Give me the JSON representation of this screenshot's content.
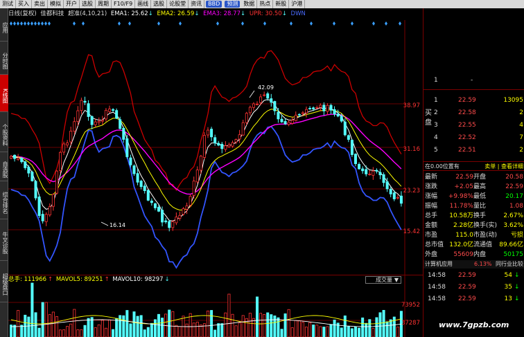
{
  "toolbar": [
    "测试",
    "买入",
    "卖出",
    "模拟",
    "开户",
    "选股",
    "周期",
    "F10/F9",
    "画线",
    "选股",
    "论股堂",
    "资讯",
    "BBD",
    "预测",
    "数据",
    "热点",
    "新股",
    "沪港"
  ],
  "side_tabs": [
    {
      "label": "应用",
      "active": false
    },
    {
      "label": "分时图",
      "active": false
    },
    {
      "label": "K线图",
      "active": true
    },
    {
      "label": "个股资料",
      "active": false
    },
    {
      "label": "自选股",
      "active": false
    },
    {
      "label": "综合排名",
      "active": false
    },
    {
      "label": "牛叉诊股",
      "active": false
    },
    {
      "label": "超级盘口",
      "active": false
    }
  ],
  "legend": {
    "period": "日线(复权)",
    "stock": "佳都科技",
    "indicator": "超准(4,10,21)",
    "ema1": "EMA1: 25.62",
    "ema2": "EMA2: 26.59",
    "ema3": "EMA3: 28.77",
    "upr": "UPR: 30.50",
    "dwn": "DWN: 23.17"
  },
  "kline": {
    "price_labels": [
      "38.97",
      "31.16",
      "23.23",
      "15.42"
    ],
    "high_label": "42.09",
    "low_label": "16.14",
    "colors": {
      "up": "#ff3333",
      "down": "#54ffff",
      "ema1": "#ffffff",
      "ema2": "#ffff00",
      "ema3": "#ff00ff",
      "upr": "#cc0000",
      "dwn": "#3355ff"
    }
  },
  "volume": {
    "total": "总手: 111966",
    "mavol5": "MAVOL5: 89251",
    "mavol10": "MAVOL10: 98297",
    "arrow_up": "↑",
    "arrow_down": "↓",
    "labels": [
      "73952",
      "37287"
    ],
    "indicator_select": "成交量"
  },
  "orderbook": {
    "ask": [
      {
        "idx": "1",
        "price": "",
        "vol": "",
        "sep": "-"
      }
    ],
    "bid_label": "买盘",
    "bid": [
      {
        "idx": "1",
        "price": "22.59",
        "vol": "13095"
      },
      {
        "idx": "2",
        "price": "22.58",
        "vol": "2"
      },
      {
        "idx": "3",
        "price": "22.55",
        "vol": "4"
      },
      {
        "idx": "4",
        "price": "22.52",
        "vol": "7"
      },
      {
        "idx": "5",
        "price": "22.51",
        "vol": "2"
      }
    ]
  },
  "position": {
    "left": "在0.00位置有",
    "right": "卖单 | 查看详细"
  },
  "stats": [
    {
      "l1": "最新",
      "v1": "22.59",
      "c1": "#ff4b4b",
      "l2": "开盘",
      "v2": "20.58",
      "c2": "#ff4b4b"
    },
    {
      "l1": "涨跌",
      "v1": "+2.05",
      "c1": "#ff4b4b",
      "l2": "最高",
      "v2": "22.59",
      "c2": "#ff4b4b"
    },
    {
      "l1": "涨幅",
      "v1": "+9.98%",
      "c1": "#ff4b4b",
      "l2": "最低",
      "v2": "20.17",
      "c2": "#00ff00"
    },
    {
      "l1": "振幅",
      "v1": "11.78%",
      "c1": "#ff4b4b",
      "l2": "量比",
      "v2": "1.08",
      "c2": "#ff4b4b"
    },
    {
      "l1": "总手",
      "v1": "10.58万",
      "c1": "#ffff00",
      "l2": "换手",
      "v2": "2.67%",
      "c2": "#ffff00"
    },
    {
      "l1": "金额",
      "v1": "2.28亿",
      "c1": "#ffff00",
      "l2": "换手(实)",
      "v2": "3.62%",
      "c2": "#ffff00"
    },
    {
      "l1": "市盈",
      "v1": "115.0",
      "c1": "#ffff00",
      "l2": "市盈(动)",
      "v2": "亏损",
      "c2": "#ffff00"
    },
    {
      "l1": "总市值",
      "v1": "132.0亿",
      "c1": "#ffff00",
      "l2": "流通值",
      "v2": "89.66亿",
      "c2": "#ffff00"
    },
    {
      "l1": "外盘",
      "v1": "55609",
      "c1": "#ff4b4b",
      "l2": "内盘",
      "v2": "50175",
      "c2": "#00ff00"
    }
  ],
  "industry": {
    "name": "计算机应用",
    "pct": "6.13%",
    "link": "同行业比较"
  },
  "ticks": [
    {
      "time": "14:58",
      "price": "22.59",
      "vol": "54",
      "dir": "↓",
      "dir_color": "#00ff00"
    },
    {
      "time": "14:58",
      "price": "22.59",
      "vol": "35",
      "dir": "↓",
      "dir_color": "#00ff00"
    },
    {
      "time": "14:58",
      "price": "22.59",
      "vol": "13",
      "dir": "↓",
      "dir_color": "#00ff00"
    }
  ],
  "watermark": "www.7gpzb.com"
}
